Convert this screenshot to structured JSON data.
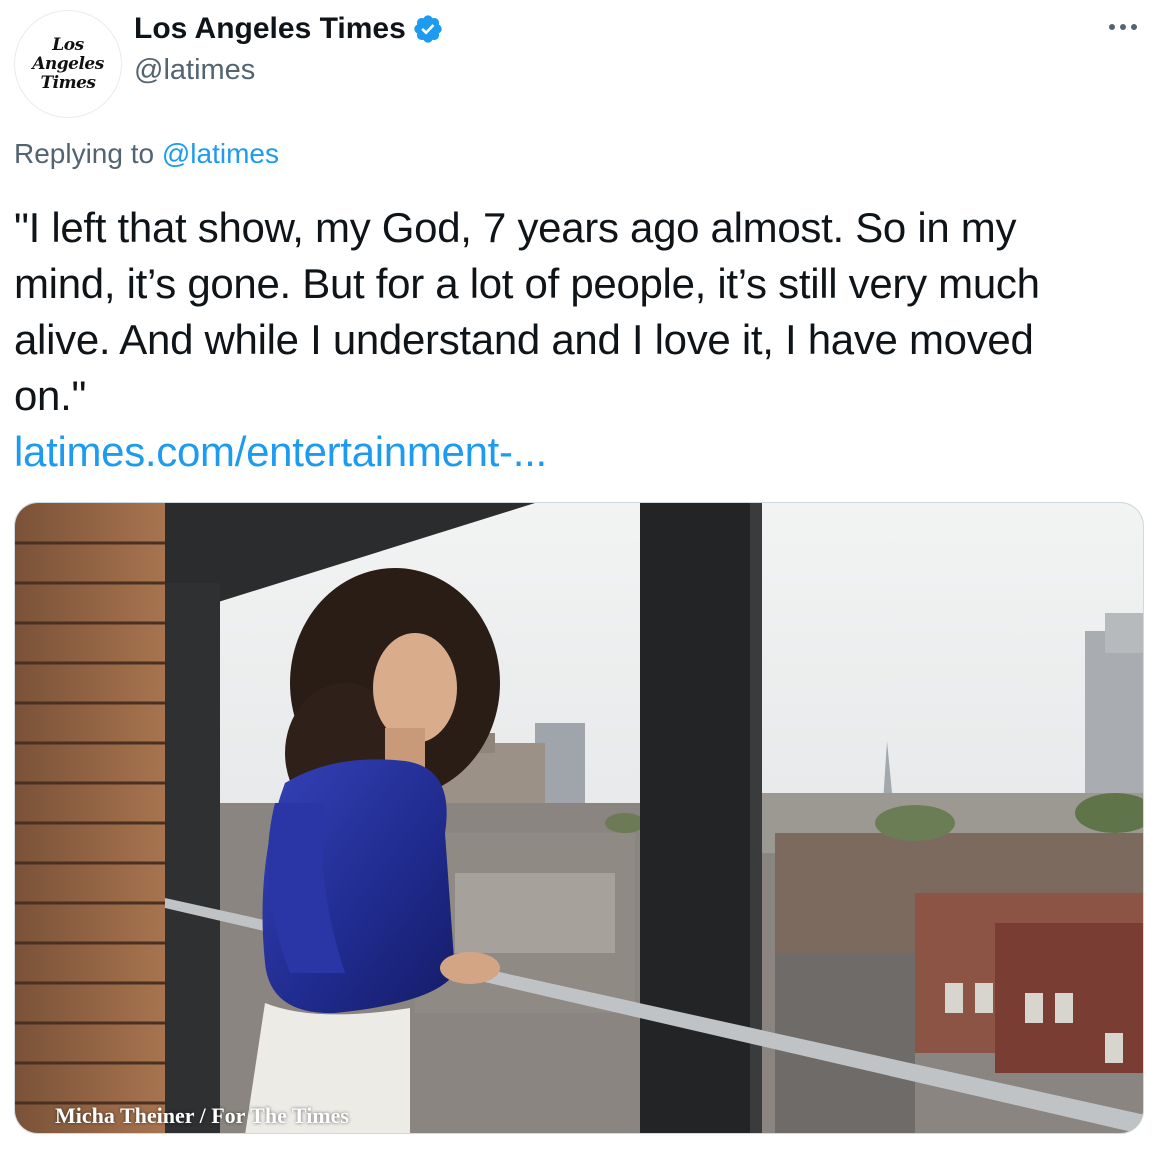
{
  "tweet": {
    "avatar_text": "Los\nAngeles\nTimes",
    "display_name": "Los Angeles Times",
    "handle": "@latimes",
    "more_icon": "more-horizontal-icon",
    "verified_icon": "verified-badge-icon",
    "replying_prefix": "Replying to",
    "replying_to": "@latimes",
    "text": "\"I left that show, my God, 7 years ago almost. So in my\nmind, it’s gone. But for a lot of people, it’s still very much\nalive. And while I understand and I love it, I have moved\non.\"",
    "link": "latimes.com/entertainment-...",
    "photo_credit": "Micha Theiner / For The Times"
  },
  "colors": {
    "link": "#1d9bf0",
    "secondary_text": "#536471",
    "primary_text": "#0f1419",
    "verified": "#1d9bf0"
  }
}
